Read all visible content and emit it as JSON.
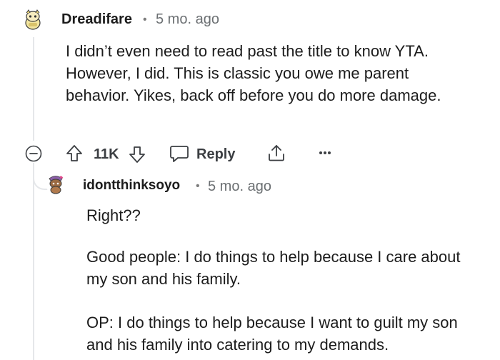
{
  "comments": [
    {
      "username": "Dreadifare",
      "separator": "•",
      "age": "5 mo. ago",
      "body": "I didn’t even need to read past the title to know YTA. However, I did. This is classic you owe me parent behavior. Yikes, back off before you do more damage.",
      "actions": {
        "collapse_icon": "collapse-minus-icon",
        "upvote_icon": "upvote-arrow-icon",
        "score": "11K",
        "downvote_icon": "downvote-arrow-icon",
        "reply_icon": "reply-bubble-icon",
        "reply_label": "Reply",
        "share_icon": "share-icon",
        "more_icon": "more-dots-icon"
      }
    },
    {
      "username": "idontthinksoyo",
      "separator": "•",
      "age": "5 mo. ago",
      "paragraphs": [
        "Right??",
        "Good people: I do things to help because I care about my son and his family.",
        "OP: I do things to help because I want to guilt my son and his family into catering to my demands."
      ]
    }
  ],
  "colors": {
    "text": "#1c1c1c",
    "meta": "#6b6f72",
    "thread_line": "#e5e7ea",
    "icon": "#3b3e42"
  }
}
